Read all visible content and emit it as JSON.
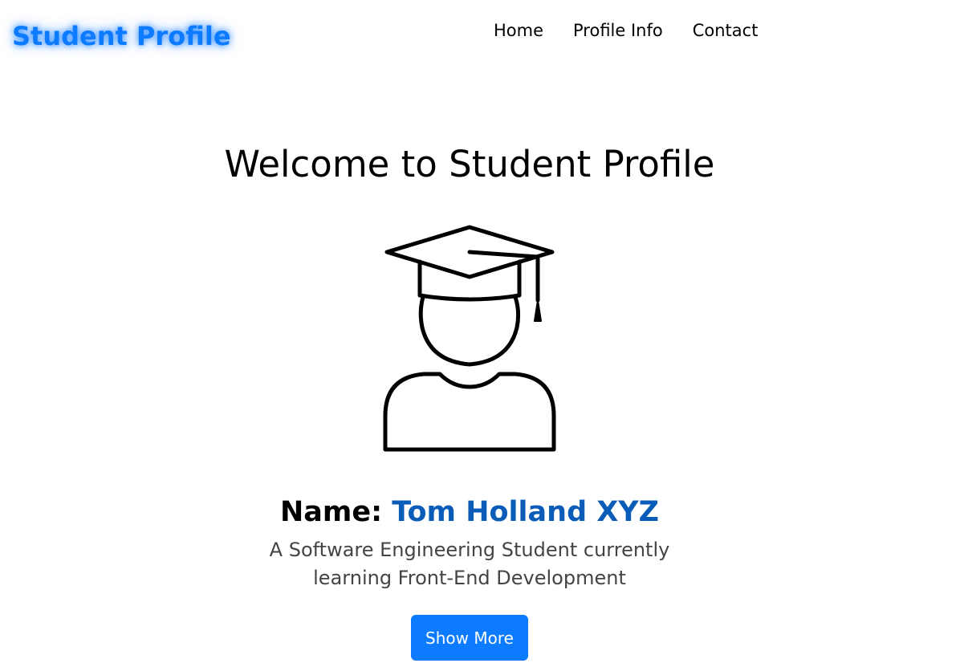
{
  "navbar": {
    "brand": "Student Profile",
    "links": [
      {
        "label": "Home"
      },
      {
        "label": "Profile Info"
      },
      {
        "label": "Contact"
      }
    ]
  },
  "hero": {
    "title": "Welcome to Student Profile",
    "avatar_icon": "graduate-student-icon",
    "name_label": "Name:",
    "name_value": "Tom Holland XYZ",
    "description": "A Software Engineering Student currently learning Front-End Development",
    "button_label": "Show More"
  },
  "colors": {
    "accent": "#0d7bff",
    "name": "#0b5cb8"
  }
}
